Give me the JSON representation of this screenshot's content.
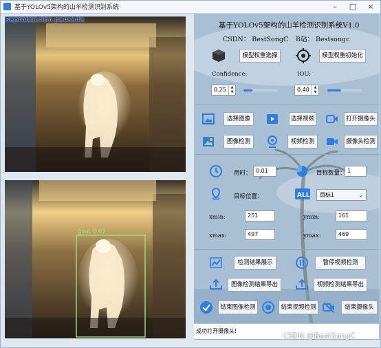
{
  "window": {
    "title": "基于YOLOv5架构的山羊检测识别系统",
    "overlay_text": "Reproducción pausada",
    "controls": {
      "minimize": "–",
      "maximize": "□",
      "close": "×"
    }
  },
  "video": {
    "detection_label": "goat  0.65"
  },
  "panel": {
    "title": "基于YOLOv5架构的山羊检测识别系统V1.0",
    "credit_left": "CSDN：  BestSongC",
    "credit_right": "B站：  Bestsongc",
    "buttons": {
      "select_model": "模型权重选择",
      "init_model": "模型权重初始化",
      "select_image": "选择图像",
      "select_video": "选择视频",
      "open_camera": "打开摄像头",
      "detect_image": "图像检测",
      "detect_video": "视频检测",
      "detect_camera": "摄像头检测",
      "show_results": "检测结果展示",
      "pause_video": "暂停视频检测",
      "export_image": "图像检测结果导出",
      "export_video": "视频检测结果导出",
      "stop_image": "结束图像检测",
      "stop_video": "结束视频检测",
      "stop_camera": "结束摄像头"
    },
    "confidence_label": "Confidence:",
    "confidence_value": "0.25",
    "confidence_level": 0.25,
    "iou_label": "IOU:",
    "iou_value": "0.40",
    "iou_level": 0.4,
    "time_label": "用时：",
    "time_value": "0.01",
    "target_count_label": "目标数量：",
    "target_count_value": "1",
    "target_position_label": "目标位置：",
    "target_select_value": "目标1",
    "xmin_label": "xmin:",
    "xmin_value": "251",
    "ymin_label": "ymin:",
    "ymin_value": "161",
    "xmax_label": "xmax:",
    "xmax_value": "497",
    "ymax_label": "ymax:",
    "ymax_value": "469",
    "status_text": "成功打开摄像头!"
  },
  "watermark": "CSDN @BestSongC",
  "colors": {
    "accent": "#2f7de1",
    "detection_box": "#9be37c"
  }
}
